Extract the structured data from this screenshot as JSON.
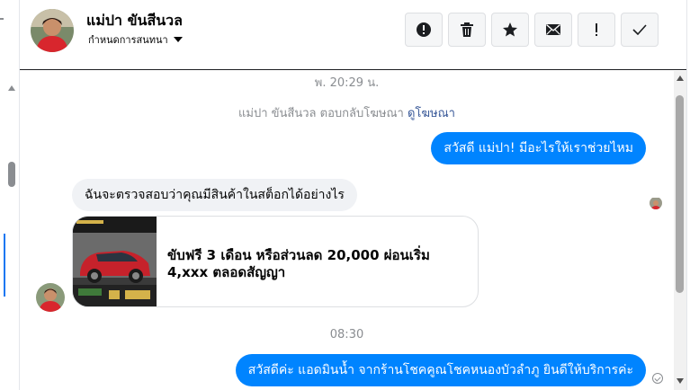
{
  "header": {
    "name": "แม่ปา ขันสีนวล",
    "subtitle": "กำหนดการสนทนา",
    "toolbar": [
      {
        "icon": "alert-circle-icon"
      },
      {
        "icon": "trash-icon"
      },
      {
        "icon": "star-icon"
      },
      {
        "icon": "envelope-icon"
      },
      {
        "icon": "exclamation-icon"
      },
      {
        "icon": "check-icon"
      }
    ]
  },
  "chat": {
    "timestamp_1": "พ. 20:29 น.",
    "ad_reply_text": "แม่ปา ขันสีนวล ตอบกลับโฆษณา",
    "ad_reply_link": "ดูโฆษณา",
    "msg_out_1": "สวัสดี แม่ปา! มีอะไรให้เราช่วยไหม",
    "msg_in_1": "ฉันจะตรวจสอบว่าคุณมีสินค้าในสต็อกได้อย่างไร",
    "card_title": "ขับฟรี 3 เดือน หรือส่วนลด 20,000 ผ่อนเริ่ม 4,xxx ตลอดสัญญา",
    "timestamp_2": "08:30",
    "msg_out_2": "สวัสดีค่ะ แอดมินน้ำ จากร้านโชคคูณโชคหนองบัวลำภู ยินดีให้บริการค่ะ"
  },
  "colors": {
    "outgoing_bubble": "#0084ff",
    "incoming_bubble": "#f0f2f5",
    "link": "#385898"
  }
}
